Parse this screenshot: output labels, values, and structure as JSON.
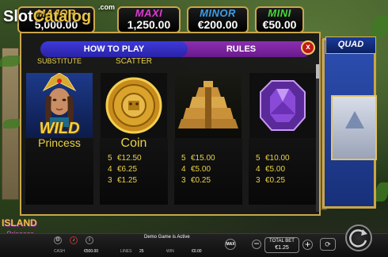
{
  "watermark": {
    "slot": "Slot",
    "catalog": "Catalog",
    "com": ".com"
  },
  "jackpots": [
    {
      "name": "MAJOR",
      "value": "5,000.00",
      "color": "#e9c242"
    },
    {
      "name": "MAXI",
      "value": "1,250.00",
      "color": "#e03ad8"
    },
    {
      "name": "MINOR",
      "value": "€200.00",
      "color": "#3a9ee8"
    },
    {
      "name": "MINI",
      "value": "€50.00",
      "color": "#45d838"
    }
  ],
  "reels_badge": "QUAD",
  "tabs": {
    "how_to_play": "HOW TO PLAY",
    "rules": "RULES"
  },
  "close": "x",
  "paytable": {
    "substitute_label": "SUBSTITUTE",
    "scatter_label": "SCATTER",
    "symbols": [
      {
        "icon": "princess-wild-icon",
        "overlay": "WILD",
        "name": "Princess",
        "pays": []
      },
      {
        "icon": "gold-coin-icon",
        "name": "Coin",
        "pays": [
          {
            "count": "5",
            "value": "€12.50"
          },
          {
            "count": "4",
            "value": "€6.25"
          },
          {
            "count": "3",
            "value": "€1.25"
          }
        ]
      },
      {
        "icon": "pyramid-icon",
        "name": "",
        "pays": [
          {
            "count": "5",
            "value": "€15.00"
          },
          {
            "count": "4",
            "value": "€5.00"
          },
          {
            "count": "3",
            "value": "€0.25"
          }
        ]
      },
      {
        "icon": "purple-gem-icon",
        "name": "",
        "pays": [
          {
            "count": "5",
            "value": "€10.00"
          },
          {
            "count": "4",
            "value": "€5.00"
          },
          {
            "count": "3",
            "value": "€0.25"
          }
        ]
      }
    ]
  },
  "bottom": {
    "game_logo": "ISLAND",
    "game_logo_sub": "Princess",
    "notice": "Demo Game is Active",
    "cash_label": "CASH",
    "cash_value": "€500.00",
    "lines_label": "LINES",
    "lines_value": "25",
    "win_label": "WIN",
    "win_value": "€0.00",
    "max_label": "MAX",
    "total_bet_label": "TOTAL BET",
    "total_bet_value": "€1.25"
  }
}
